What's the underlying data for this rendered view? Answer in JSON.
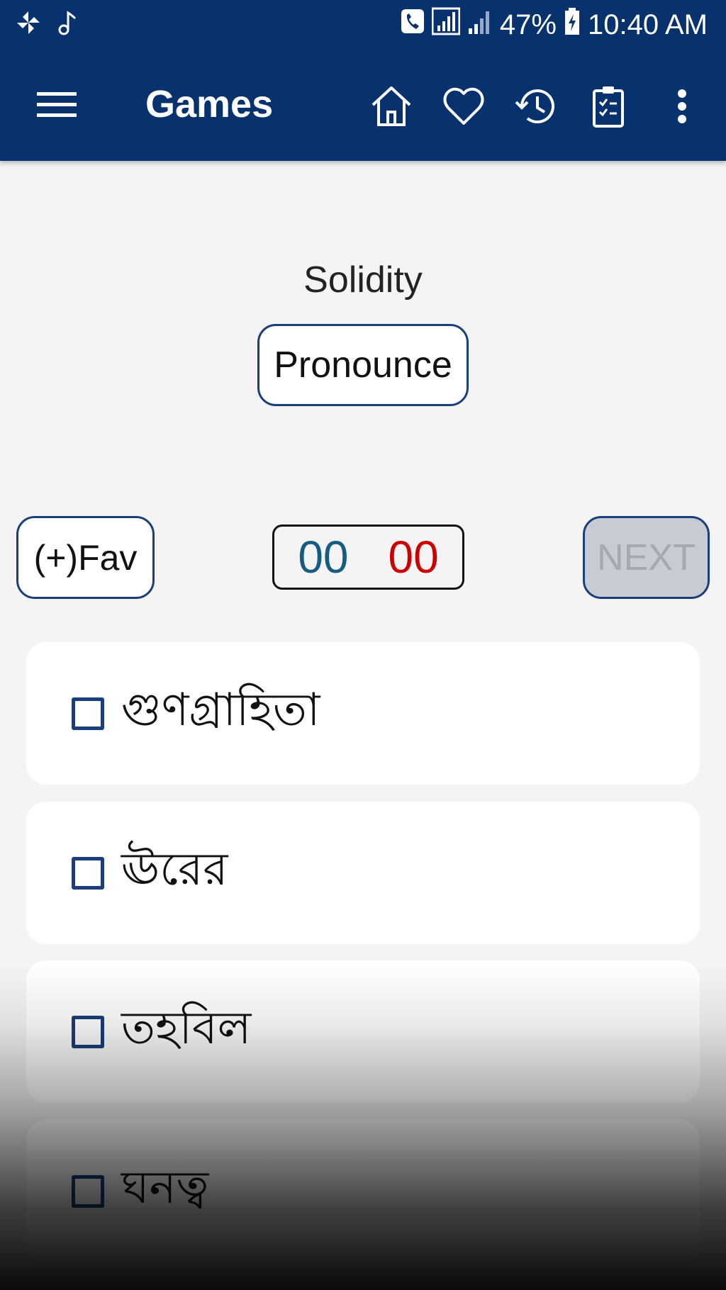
{
  "status_bar": {
    "left_icons": [
      "pinwheel-icon",
      "music-note-icon"
    ],
    "right_icons": [
      "call-icon",
      "signal-icon",
      "signal-weak-icon",
      "battery-charging-icon"
    ],
    "battery": "47%",
    "time": "10:40 AM"
  },
  "app_bar": {
    "title": "Games",
    "icons": [
      "menu-icon",
      "home-icon",
      "heart-icon",
      "history-icon",
      "clipboard-check-icon",
      "more-vert-icon"
    ],
    "color": "#07326d"
  },
  "quiz": {
    "word": "Solidity",
    "pronounce_label": "Pronounce",
    "fav_label": "(+)Fav",
    "next_label": "NEXT",
    "score_correct": "00",
    "score_wrong": "00",
    "correct_color": "#155b82",
    "wrong_color": "#cc0000",
    "options": [
      "গুণগ্রাহিতা",
      "ঊরের",
      "তহবিল",
      "ঘনত্ব"
    ]
  }
}
